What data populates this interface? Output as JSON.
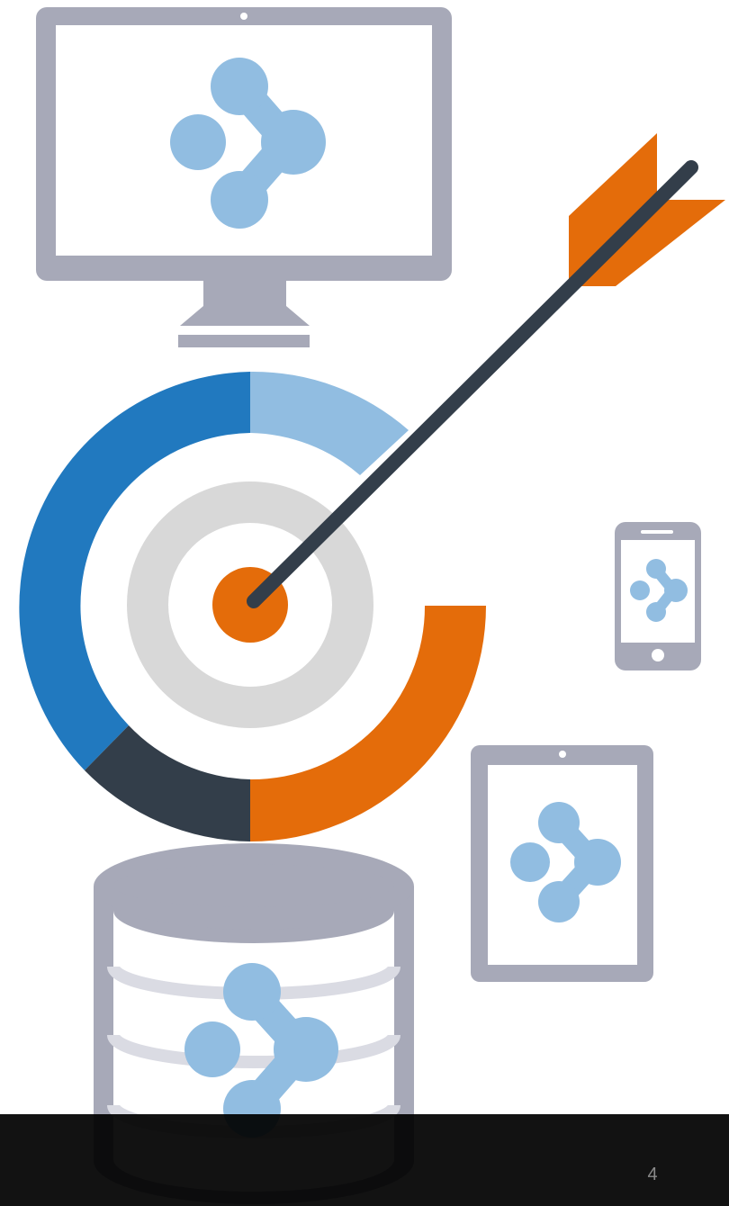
{
  "slide": {
    "page_number": "4"
  },
  "colors": {
    "device_gray": "#a7a9b8",
    "device_screen": "#ffffff",
    "logo_blue": "#91bde1",
    "ring_blue": "#2179bf",
    "ring_light_blue": "#91bde1",
    "ring_orange": "#e46c0a",
    "ring_dark": "#333e4a",
    "ring_gray": "#d8d8d8",
    "arrow_shaft": "#333e4a",
    "arrow_fletching": "#e46c0a",
    "database_stripe": "#dadbe3",
    "footer": "#000000"
  },
  "icons": [
    "desktop-monitor-icon",
    "target-icon",
    "arrow-icon",
    "smartphone-icon",
    "tablet-icon",
    "database-icon",
    "network-logo-icon"
  ]
}
